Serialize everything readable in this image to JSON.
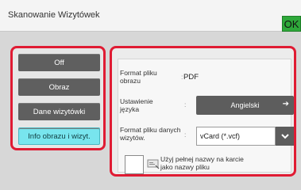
{
  "header": {
    "title": "Skanowanie Wizytówek",
    "ok_label": "OK"
  },
  "modes": [
    {
      "label": "Off",
      "selected": false
    },
    {
      "label": "Obraz",
      "selected": false
    },
    {
      "label": "Dane wizytówki",
      "selected": false
    },
    {
      "label": "Info obrazu i wizyt.",
      "selected": true
    }
  ],
  "settings": {
    "format_obrazu_label": "Format pliku obrazu",
    "format_obrazu_value": "PDF",
    "jezyk_label": "Ustawienie języka",
    "jezyk_value": "Angielski",
    "format_wizytowki_label": "Format pliku danych wizytów.",
    "format_wizytowki_value": "vCard (*.vcf)",
    "fullname_label": "Użyj pełnej nazwy na karcie jako nazwy pliku",
    "fullname_checked": false,
    "separator": ":"
  },
  "icons": {
    "ok": "ok-icon",
    "arrow": "right-arrow-icon",
    "chevron": "chevron-down-icon",
    "card": "card-icon"
  }
}
